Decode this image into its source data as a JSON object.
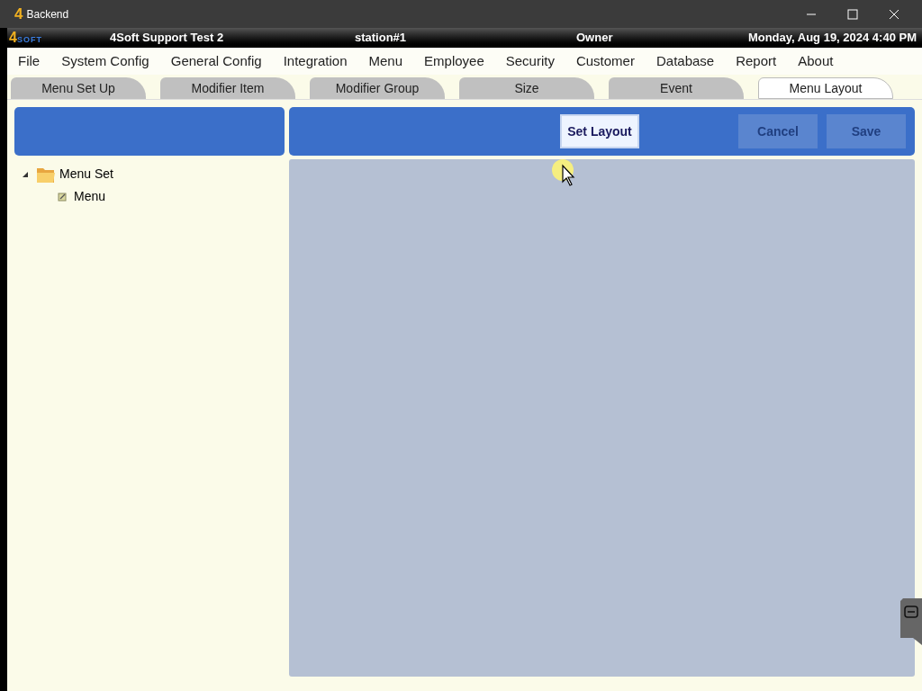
{
  "window": {
    "logo": "4",
    "title": "Backend"
  },
  "header": {
    "logo": "4",
    "logo_word": "SOFT",
    "company": "4Soft Support Test 2",
    "station": "station#1",
    "user": "Owner",
    "datetime": "Monday, Aug 19, 2024 4:40 PM"
  },
  "menu": [
    "File",
    "System Config",
    "General Config",
    "Integration",
    "Menu",
    "Employee",
    "Security",
    "Customer",
    "Database",
    "Report",
    "About"
  ],
  "tabs": [
    {
      "label": "Menu Set Up",
      "selected": false
    },
    {
      "label": "Modifier Item",
      "selected": false
    },
    {
      "label": "Modifier Group",
      "selected": false
    },
    {
      "label": "Size",
      "selected": false
    },
    {
      "label": "Event",
      "selected": false
    },
    {
      "label": "Menu Layout",
      "selected": true
    }
  ],
  "toolbar": [
    {
      "label": "Set Layout",
      "disabled": false
    },
    {
      "label": "Cancel",
      "disabled": true
    },
    {
      "label": "Save",
      "disabled": true
    }
  ],
  "tree": [
    {
      "label": "Menu Set",
      "expanded": true,
      "children": [
        {
          "label": "Menu"
        }
      ]
    }
  ]
}
